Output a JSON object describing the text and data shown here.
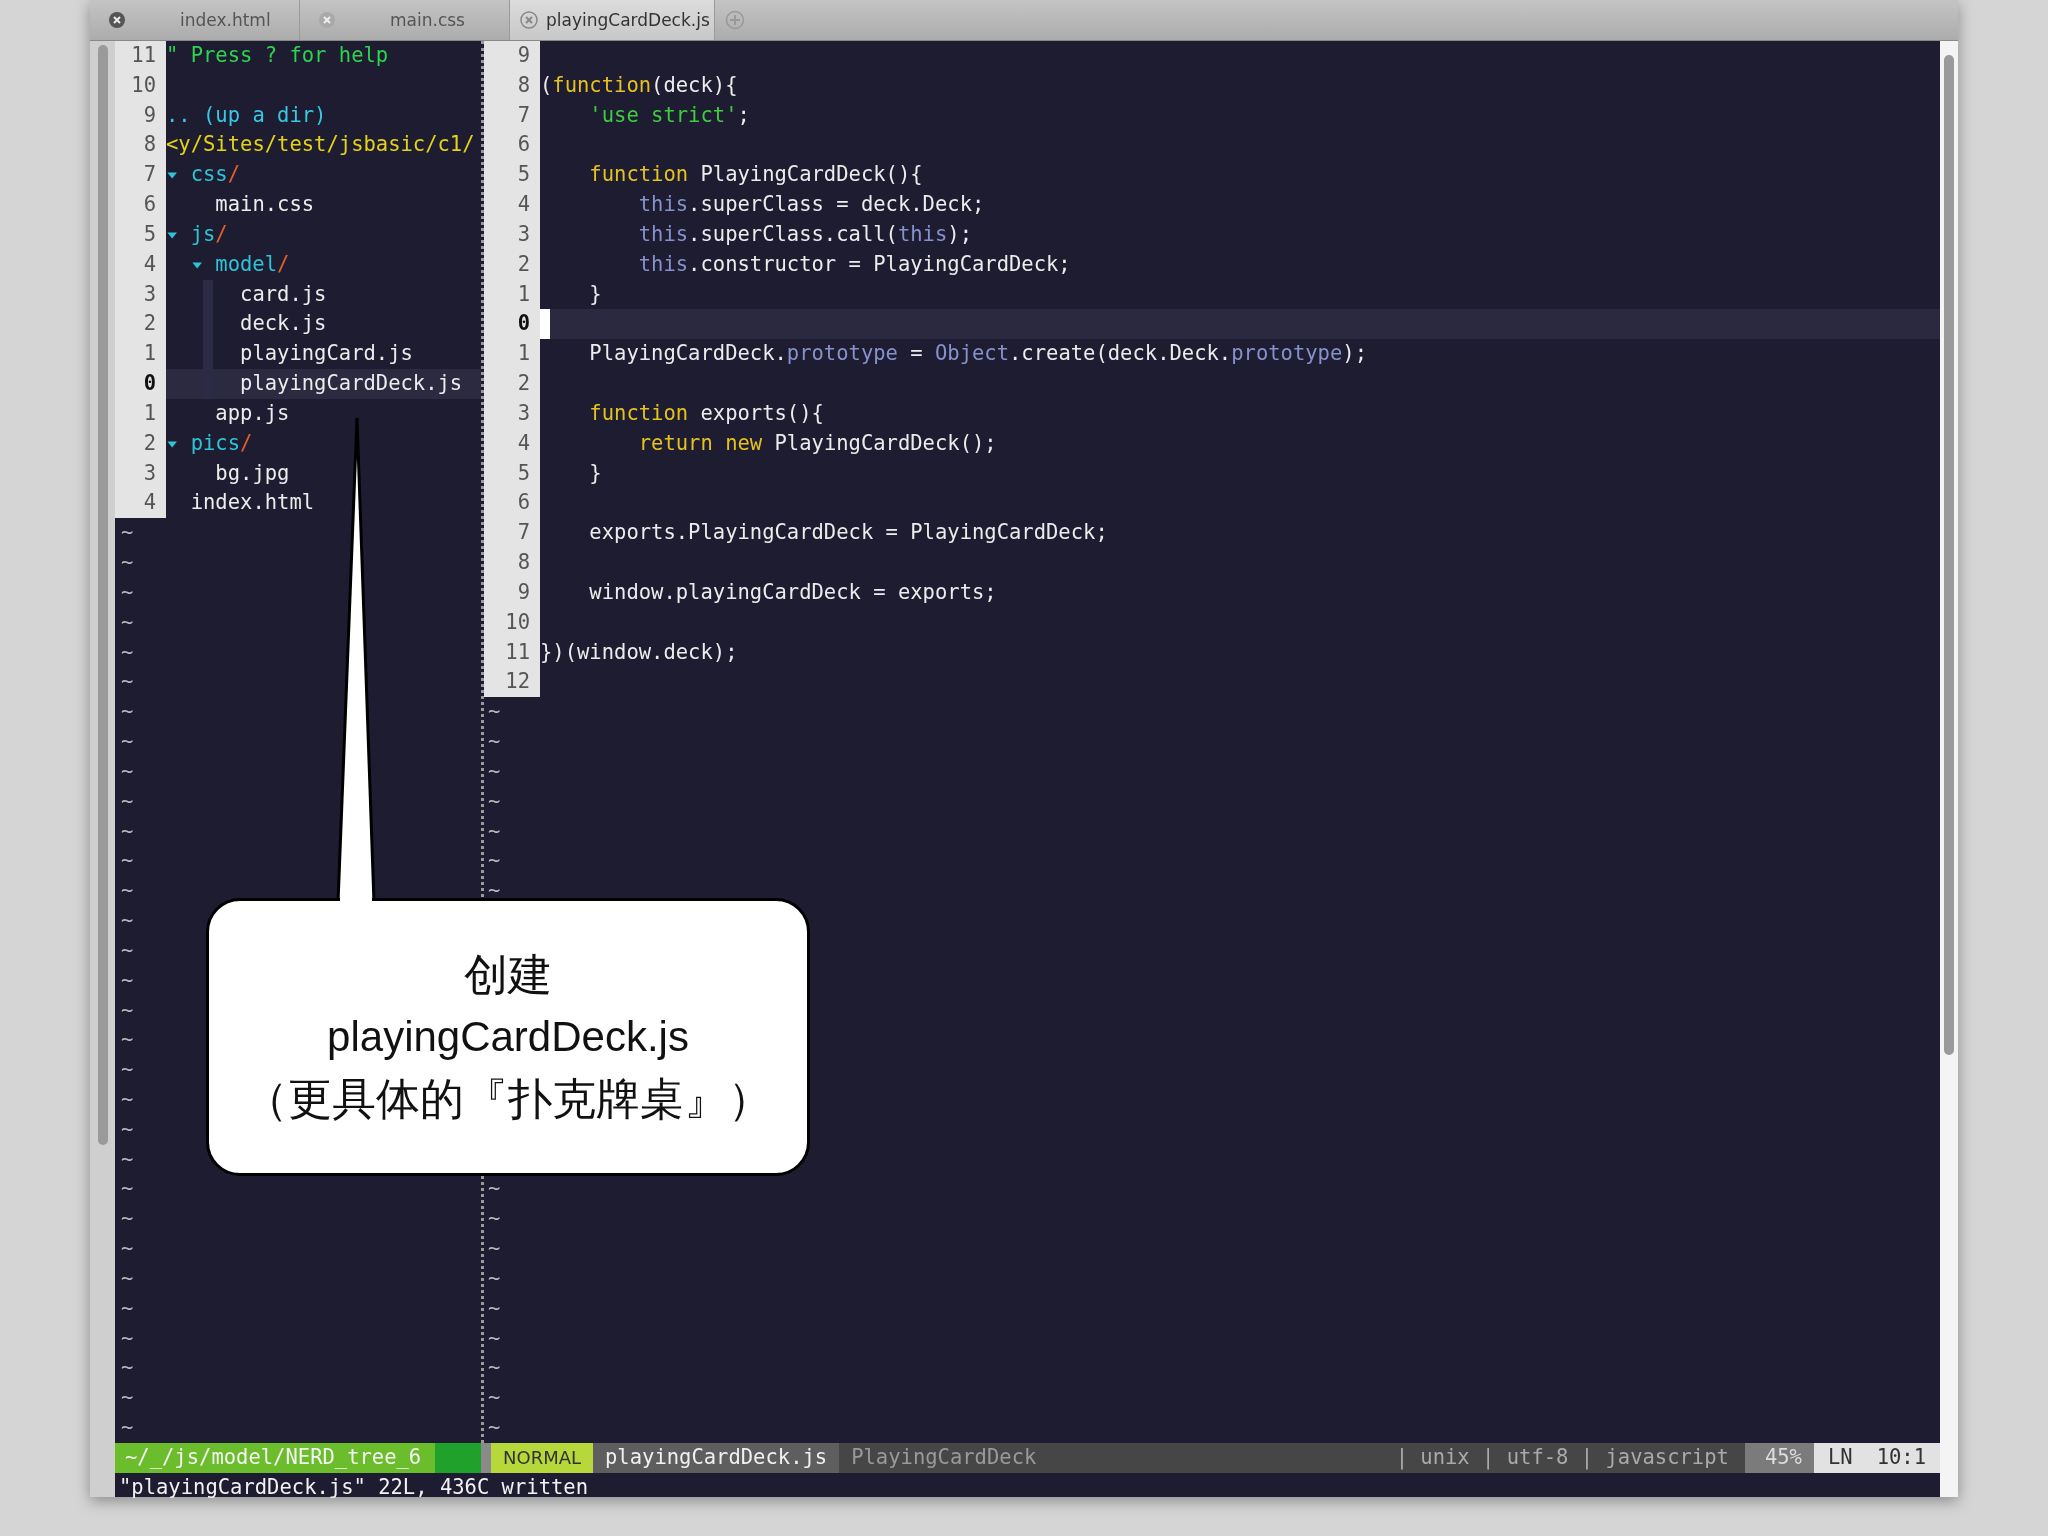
{
  "tabs": [
    {
      "label": "index.html",
      "selected": false
    },
    {
      "label": "main.css",
      "selected": false
    },
    {
      "label": "playingCardDeck.js",
      "selected": true
    }
  ],
  "nerdtree": {
    "rows": [
      {
        "n": "11",
        "kind": "help",
        "text": "\" Press ? for help"
      },
      {
        "n": "10"
      },
      {
        "n": "9",
        "kind": "up",
        "text": ".. (up a dir)"
      },
      {
        "n": "8",
        "kind": "root",
        "text": "<y/Sites/test/jsbasic/c1/"
      }
    ],
    "tree": [
      {
        "n": "7",
        "name": "css",
        "suffix": "/",
        "expanded": true,
        "selected": false,
        "children": [
          {
            "n": "6",
            "name": "main.css",
            "selected": false
          }
        ]
      },
      {
        "n": "5",
        "name": "js",
        "suffix": "/",
        "expanded": true,
        "selected": false,
        "children": [
          {
            "n": "4",
            "name": "model",
            "suffix": "/",
            "expanded": true,
            "selected": false,
            "children": [
              {
                "n": "3",
                "name": "card.js",
                "selected": false
              },
              {
                "n": "2",
                "name": "deck.js",
                "selected": false
              },
              {
                "n": "1",
                "name": "playingCard.js",
                "selected": false
              },
              {
                "n": "0",
                "name": "playingCardDeck.js",
                "selected": true
              }
            ]
          },
          {
            "n": "1",
            "name": "app.js",
            "selected": false
          }
        ]
      },
      {
        "n": "2",
        "name": "pics",
        "suffix": "/",
        "expanded": true,
        "selected": false,
        "children": [
          {
            "n": "3",
            "name": "bg.jpg",
            "selected": false
          }
        ]
      },
      {
        "n": "4",
        "name": "index.html",
        "selected": false
      }
    ],
    "tildes": [
      "~",
      "~",
      "~",
      "~",
      "~",
      "~",
      "~",
      "~",
      "~",
      "~",
      "~",
      "~",
      "~",
      "~",
      "~",
      "~",
      "~",
      "~",
      "~",
      "~",
      "~",
      "~",
      "~",
      "~",
      "~",
      "~",
      "~",
      "~",
      "~",
      "~",
      "~"
    ]
  },
  "editor": {
    "lines": [
      {
        "n": "9",
        "current": false
      },
      {
        "n": "8",
        "current": false,
        "tokens": [
          {
            "t": "(",
            "kind": "plain"
          },
          {
            "t": "function",
            "kind": "kw"
          },
          {
            "t": "(deck){",
            "kind": "plain"
          }
        ]
      },
      {
        "n": "7",
        "current": false,
        "tokens": [
          {
            "t": "    'use strict'",
            "kind": "str"
          },
          {
            "t": ";",
            "kind": "plain"
          }
        ]
      },
      {
        "n": "6",
        "current": false
      },
      {
        "n": "5",
        "current": false,
        "tokens": [
          {
            "t": "    function",
            "kind": "kw"
          },
          {
            "t": " PlayingCardDeck(){",
            "kind": "plain"
          }
        ]
      },
      {
        "n": "4",
        "current": false,
        "tokens": [
          {
            "t": "        this",
            "kind": "builtin"
          },
          {
            "t": ".superClass = deck.Deck;",
            "kind": "plain"
          }
        ]
      },
      {
        "n": "3",
        "current": false,
        "tokens": [
          {
            "t": "        this",
            "kind": "builtin"
          },
          {
            "t": ".superClass.call(",
            "kind": "plain"
          },
          {
            "t": "this",
            "kind": "builtin"
          },
          {
            "t": ");",
            "kind": "plain"
          }
        ]
      },
      {
        "n": "2",
        "current": false,
        "tokens": [
          {
            "t": "        this",
            "kind": "builtin"
          },
          {
            "t": ".constructor = PlayingCardDeck;",
            "kind": "plain"
          }
        ]
      },
      {
        "n": "1",
        "current": false,
        "tokens": [
          {
            "t": "    }",
            "kind": "plain"
          }
        ]
      },
      {
        "n": "0",
        "current": true
      },
      {
        "n": "1",
        "current": false,
        "tokens": [
          {
            "t": "    PlayingCardDeck.",
            "kind": "plain"
          },
          {
            "t": "prototype",
            "kind": "builtin"
          },
          {
            "t": " = ",
            "kind": "plain"
          },
          {
            "t": "Object",
            "kind": "builtin"
          },
          {
            "t": ".create(deck.Deck.",
            "kind": "plain"
          },
          {
            "t": "prototype",
            "kind": "builtin"
          },
          {
            "t": ");",
            "kind": "plain"
          }
        ]
      },
      {
        "n": "2",
        "current": false
      },
      {
        "n": "3",
        "current": false,
        "tokens": [
          {
            "t": "    function",
            "kind": "kw"
          },
          {
            "t": " exports(){",
            "kind": "plain"
          }
        ]
      },
      {
        "n": "4",
        "current": false,
        "tokens": [
          {
            "t": "        return new",
            "kind": "kw"
          },
          {
            "t": " PlayingCardDeck();",
            "kind": "plain"
          }
        ]
      },
      {
        "n": "5",
        "current": false,
        "tokens": [
          {
            "t": "    }",
            "kind": "plain"
          }
        ]
      },
      {
        "n": "6",
        "current": false
      },
      {
        "n": "7",
        "current": false,
        "tokens": [
          {
            "t": "    exports.PlayingCardDeck = PlayingCardDeck;",
            "kind": "plain"
          }
        ]
      },
      {
        "n": "8",
        "current": false
      },
      {
        "n": "9",
        "current": false,
        "tokens": [
          {
            "t": "    window.playingCardDeck = exports;",
            "kind": "plain"
          }
        ]
      },
      {
        "n": "10",
        "current": false
      },
      {
        "n": "11",
        "current": false,
        "tokens": [
          {
            "t": "})(window.deck);",
            "kind": "plain"
          }
        ]
      },
      {
        "n": "12",
        "current": false
      }
    ],
    "tildes_upper": [
      "~",
      "~",
      "~",
      "~",
      "~",
      "~",
      "~"
    ],
    "tildes_lower": [
      "~",
      "~",
      "~",
      "~",
      "~",
      "~",
      "~",
      "~",
      "~"
    ]
  },
  "status_bar": {
    "nerdtree": "~/_/js/model/NERD_tree_6",
    "mode": "NORMAL",
    "file": "playingCardDeck.js",
    "tag": "PlayingCardDeck",
    "info": "| unix | utf-8 | javascript",
    "percent": "45%",
    "position_label": "LN",
    "position": "10:1"
  },
  "command_line": "\"playingCardDeck.js\" 22L, 436C written",
  "callout": {
    "lines": [
      "创建",
      "playingCardDeck.js",
      "（更具体的『扑克牌桌』）"
    ]
  }
}
